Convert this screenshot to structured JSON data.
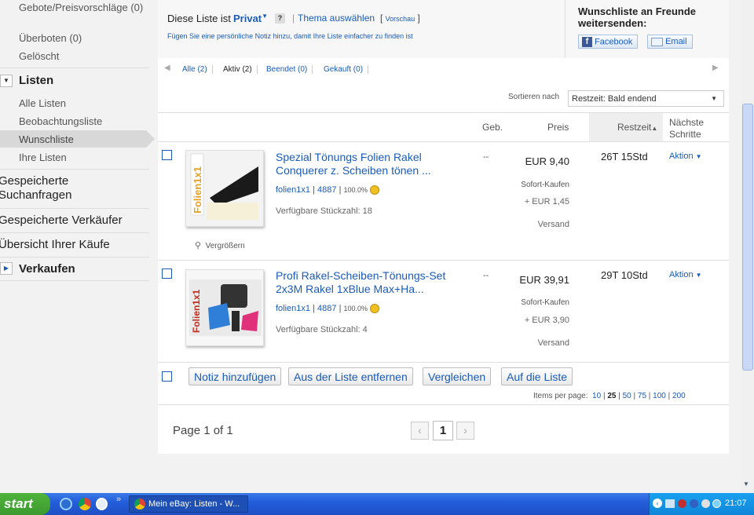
{
  "sidebar": {
    "offers": "Gebote/Preisvorschläge (0)",
    "outbid": "Überboten (0)",
    "deleted": "Gelöscht",
    "lists_header": "Listen",
    "all_lists": "Alle Listen",
    "watchlist": "Beobachtungsliste",
    "wishlist": "Wunschliste",
    "your_lists": "Ihre Listen",
    "saved_searches": "Gespeicherte Suchanfragen",
    "saved_sellers": "Gespeicherte Verkäufer",
    "purchases": "Übersicht Ihrer Käufe",
    "selling": "Verkaufen"
  },
  "header": {
    "list_is": "Diese Liste ist",
    "privacy": "Privat",
    "help": "?",
    "theme": "Thema auswählen",
    "preview": "Vorschau",
    "note_hint": "Fügen Sie eine persönliche Notiz hinzu, damit Ihre Liste einfacher zu finden ist",
    "share_title": "Wunschliste an Freunde weitersenden:",
    "facebook": "Facebook",
    "email": "Email"
  },
  "tabs": [
    {
      "label": "Alle (2)"
    },
    {
      "label": "Aktiv (2)"
    },
    {
      "label": "Beendet (0)"
    },
    {
      "label": "Gekauft (0)"
    }
  ],
  "sort": {
    "label": "Sortieren nach",
    "value": "Restzeit: Bald endend"
  },
  "columns": {
    "bids": "Geb.",
    "price": "Preis",
    "time_left": "Restzeit",
    "next_steps": "Nächste Schritte"
  },
  "items": [
    {
      "title": "Spezial Tönungs Folien Rakel Conquerer z. Scheiben tönen ...",
      "seller": "folien1x1",
      "feedback": "4887",
      "rating": "100.0%",
      "qty": "Verfügbare Stückzahl: 18",
      "bids": "--",
      "price": "EUR 9,40",
      "format": "Sofort-Kaufen",
      "shipping": "+ EUR 1,45",
      "shipping_label": "Versand",
      "time_left": "26T 15Std",
      "action": "Aktion",
      "enlarge": "Vergrößern"
    },
    {
      "title": "Profi Rakel-Scheiben-Tönungs-Set 2x3M Rakel 1xBlue Max+Ha...",
      "seller": "folien1x1",
      "feedback": "4887",
      "rating": "100.0%",
      "qty": "Verfügbare Stückzahl: 4",
      "bids": "--",
      "price": "EUR 39,91",
      "format": "Sofort-Kaufen",
      "shipping": "+ EUR 3,90",
      "shipping_label": "Versand",
      "time_left": "29T 10Std",
      "action": "Aktion"
    }
  ],
  "actions": {
    "add_note": "Notiz hinzufügen",
    "remove": "Aus der Liste entfernen",
    "compare": "Vergleichen",
    "to_list": "Auf die Liste"
  },
  "paging": {
    "items_per_page": "Items per page:",
    "options": [
      "10",
      "25",
      "50",
      "75",
      "100",
      "200"
    ],
    "selected": "25",
    "page_info": "Page 1 of 1",
    "current": "1"
  },
  "taskbar": {
    "start": "start",
    "window": "Mein eBay: Listen - W...",
    "clock": "21:07"
  },
  "colors": {
    "link": "#1a5bb8",
    "taskbar": "#245edb",
    "start": "#3c9a2e"
  }
}
